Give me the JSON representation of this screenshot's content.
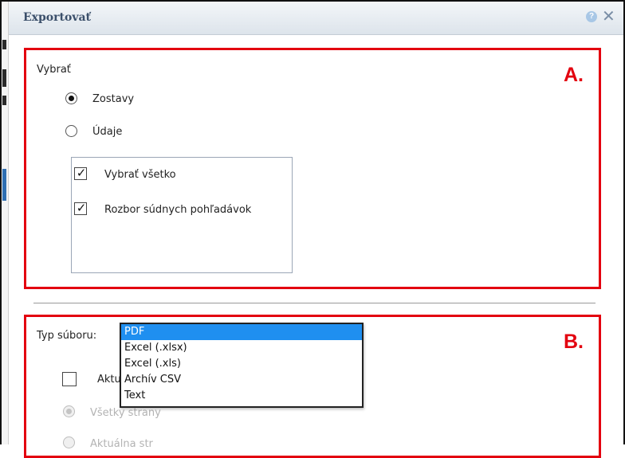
{
  "dialog": {
    "title": "Exportovať",
    "help_glyph": "?",
    "close_glyph": "✕"
  },
  "section_a": {
    "letter": "A.",
    "group_label": "Vybrať",
    "radios": [
      {
        "label": "Zostavy",
        "checked": true
      },
      {
        "label": "Údaje",
        "checked": false
      }
    ],
    "checkboxes": [
      {
        "label": "Vybrať všetko",
        "checked": true
      },
      {
        "label": "Rozbor súdnych pohľadávok",
        "checked": true
      }
    ]
  },
  "section_b": {
    "letter": "B.",
    "file_type_label": "Typ súboru:",
    "dropdown_options": [
      "PDF",
      "Excel (.xlsx)",
      "Excel (.xls)",
      "Archív CSV",
      "Text"
    ],
    "selected_option": "PDF",
    "current_checkbox_label_partial": "Aktua",
    "page_radios": [
      {
        "label": "Všetky strany",
        "checked": true
      },
      {
        "label": "Aktuálna str",
        "checked": false
      }
    ]
  },
  "check_glyph": "✓"
}
